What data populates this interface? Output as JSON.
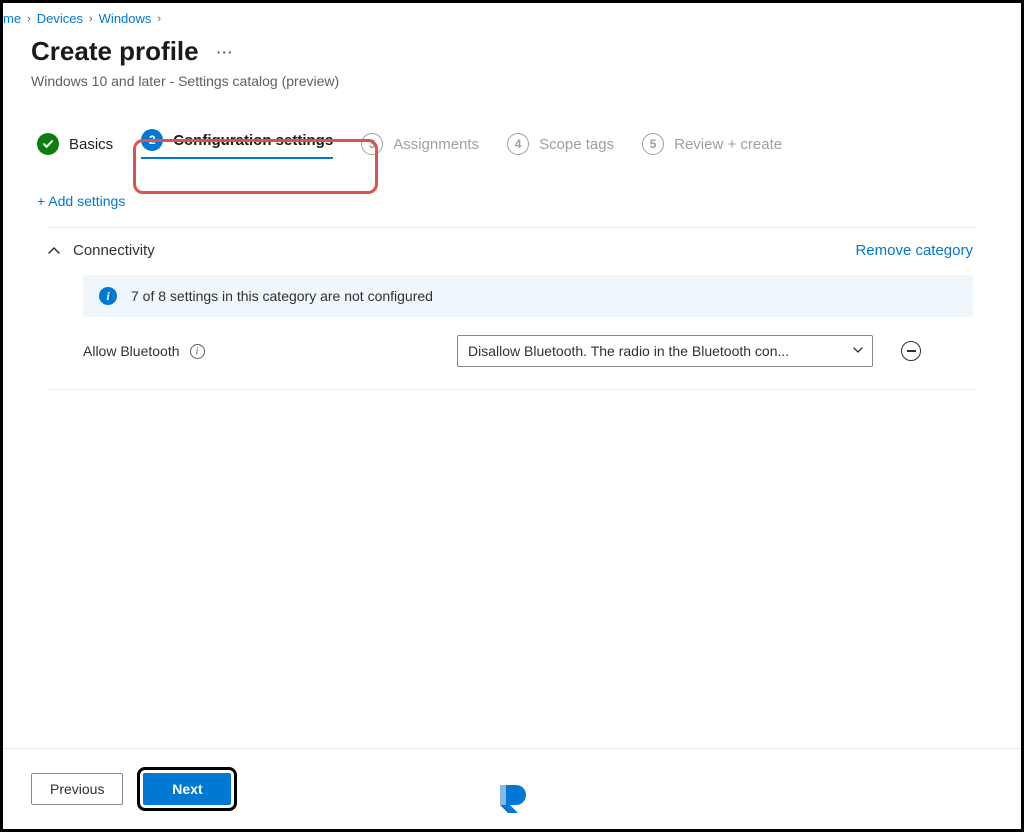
{
  "breadcrumb": {
    "home": "me",
    "devices": "Devices",
    "windows": "Windows"
  },
  "header": {
    "title": "Create profile",
    "subtitle": "Windows 10 and later - Settings catalog (preview)"
  },
  "wizard": {
    "step1": "Basics",
    "step2_num": "2",
    "step2": "Configuration settings",
    "step3_num": "3",
    "step3": "Assignments",
    "step4_num": "4",
    "step4": "Scope tags",
    "step5_num": "5",
    "step5": "Review + create"
  },
  "actions": {
    "add_settings": "+ Add settings",
    "remove_category": "Remove category"
  },
  "section": {
    "title": "Connectivity",
    "info_msg": "7 of 8 settings in this category are not configured"
  },
  "setting": {
    "label": "Allow Bluetooth",
    "selected_value": "Disallow Bluetooth. The radio in the Bluetooth con..."
  },
  "footer": {
    "previous": "Previous",
    "next": "Next"
  }
}
